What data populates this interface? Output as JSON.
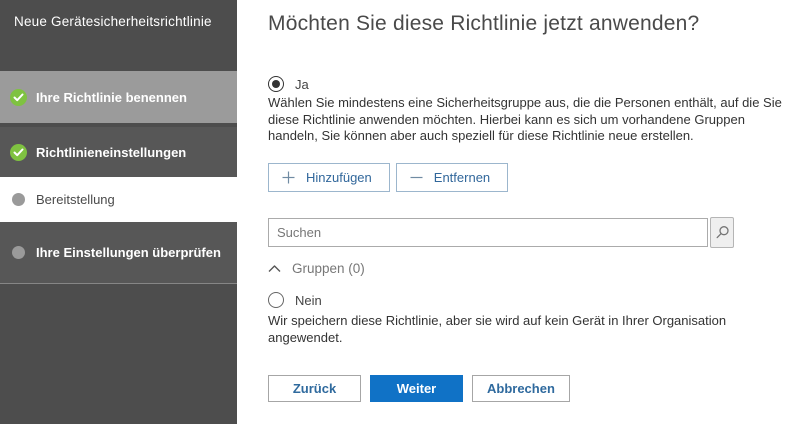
{
  "sidebar": {
    "title": "Neue Gerätesicherheitsrichtlinie",
    "steps": [
      {
        "label": "Ihre Richtlinie benennen",
        "status": "completed"
      },
      {
        "label": "Richtlinieneinstellungen",
        "status": "completed"
      },
      {
        "label": "Bereitstellung",
        "status": "active"
      },
      {
        "label": "Ihre Einstellungen überprüfen",
        "status": "pending"
      }
    ]
  },
  "main": {
    "heading": "Möchten Sie diese Richtlinie jetzt anwenden?",
    "yes_option": {
      "label": "Ja",
      "selected": true,
      "description": "Wählen Sie mindestens eine Sicherheitsgruppe aus, die die Personen enthält, auf die Sie diese Richtlinie anwenden möchten. Hierbei kann es sich um vorhandene Gruppen handeln, Sie können aber auch speziell für diese Richtlinie neue erstellen."
    },
    "add_button_label": "Hinzufügen",
    "remove_button_label": "Entfernen",
    "search": {
      "placeholder": "Suchen",
      "value": ""
    },
    "groups_header_label": "Gruppen (0)",
    "groups_count": 0,
    "no_option": {
      "label": "Nein",
      "selected": false,
      "description": "Wir speichern diese Richtlinie, aber sie wird auf kein Gerät in Ihrer Organisation angewendet."
    },
    "footer": {
      "back_label": "Zurück",
      "next_label": "Weiter",
      "cancel_label": "Abbrechen"
    }
  },
  "icons": {
    "completed_step": "check-icon",
    "pending_step": "dot-icon",
    "add": "plus-icon",
    "remove": "minus-icon",
    "search": "magnifier-icon",
    "groups_collapse": "chevron-up-icon"
  },
  "colors": {
    "primary_button_blue": "#1072c6",
    "link_blue": "#31679b",
    "success_green": "#7fc241",
    "sidebar_dark": "#4d4d4d",
    "sidebar_step_highlight": "#9b9b9b",
    "sidebar_step_normal": "#575757"
  }
}
